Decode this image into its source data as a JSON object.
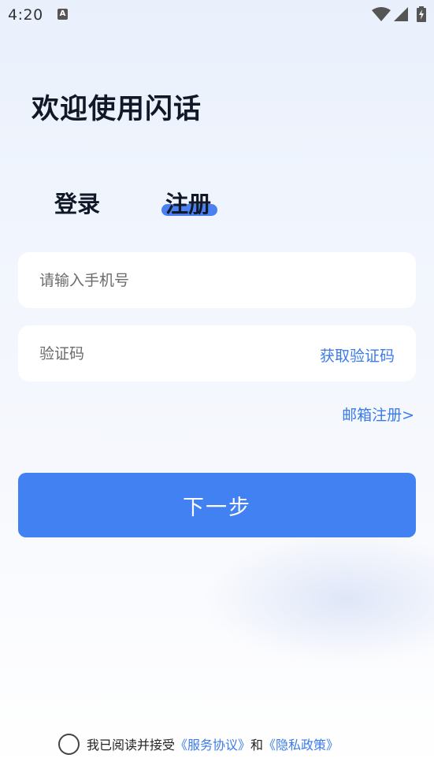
{
  "status_bar": {
    "time": "4:20",
    "a_icon_letter": "A"
  },
  "welcome": {
    "title": "欢迎使用闪话"
  },
  "tabs": [
    {
      "label": "登录",
      "active": false
    },
    {
      "label": "注册",
      "active": true
    }
  ],
  "form": {
    "phone_placeholder": "请输入手机号",
    "phone_value": "",
    "code_placeholder": "验证码",
    "code_value": "",
    "get_code_label": "获取验证码"
  },
  "email_register_label": "邮箱注册>",
  "next_button_label": "下一步",
  "agreement": {
    "checked": false,
    "prefix": "我已阅读并接受",
    "service_link": "《服务协议》",
    "and": "和",
    "privacy_link": "《隐私政策》"
  },
  "colors": {
    "accent": "#4281f2",
    "link": "#3b7be8",
    "title": "#111827"
  }
}
